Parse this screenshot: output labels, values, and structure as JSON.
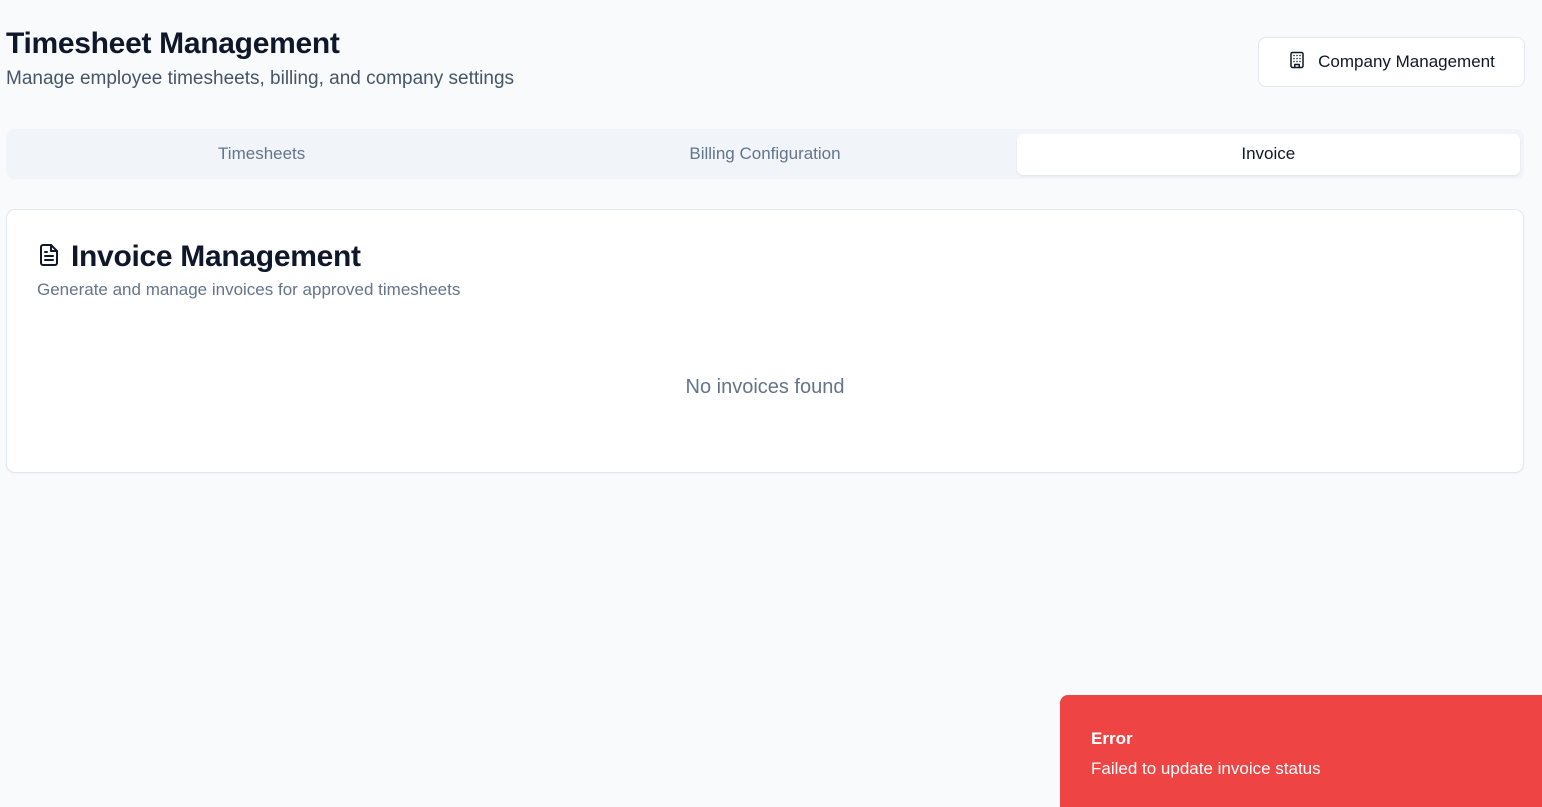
{
  "header": {
    "title": "Timesheet Management",
    "subtitle": "Manage employee timesheets, billing, and company settings"
  },
  "company_button": {
    "label": "Company Management",
    "icon": "building-icon"
  },
  "tabs": [
    {
      "label": "Timesheets",
      "active": false
    },
    {
      "label": "Billing Configuration",
      "active": false
    },
    {
      "label": "Invoice",
      "active": true
    }
  ],
  "invoice_card": {
    "icon": "file-text-icon",
    "title": "Invoice Management",
    "description": "Generate and manage invoices for approved timesheets",
    "empty_message": "No invoices found"
  },
  "toast": {
    "title": "Error",
    "message": "Failed to update invoice status",
    "color": "#ef4444"
  }
}
